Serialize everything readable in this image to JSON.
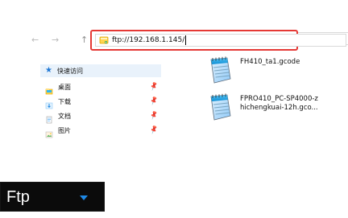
{
  "window": {
    "nav": {
      "back_icon": "arrow-left-icon",
      "forward_icon": "arrow-right-icon",
      "up_icon": "arrow-up-icon"
    },
    "address_bar": {
      "value": "ftp://192.168.1.145/",
      "icon": "ftp-location-icon",
      "highlight_color": "#e53935"
    },
    "sidebar": {
      "quick_access_label": "快速访问",
      "items": [
        {
          "label": "桌面",
          "icon": "desktop-folder-icon",
          "pinned": true
        },
        {
          "label": "下载",
          "icon": "downloads-folder-icon",
          "pinned": true
        },
        {
          "label": "文档",
          "icon": "documents-folder-icon",
          "pinned": true
        },
        {
          "label": "图片",
          "icon": "pictures-folder-icon",
          "pinned": true
        }
      ]
    },
    "files": [
      {
        "name": "FH410_ta1.gcode",
        "icon": "notepad-document-icon"
      },
      {
        "name": "FPRO410_PC-SP4000-z\nhichengkuai-12h.gco...",
        "icon": "notepad-document-icon"
      }
    ]
  },
  "ftp_dropdown": {
    "selected": "Ftp",
    "caret_color": "#1e88e5"
  }
}
